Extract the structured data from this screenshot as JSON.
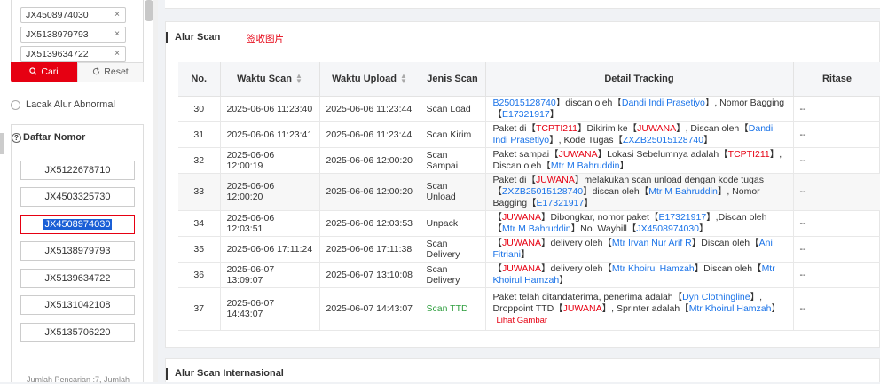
{
  "sidebar": {
    "tags": [
      "JX4508974030",
      "JX5138979793",
      "JX5139634722"
    ],
    "remove_glyph": "×",
    "cari_label": "Cari",
    "reset_label": "Reset",
    "lacak_label": "Lacak Alur Abnormal",
    "daftar_title": "Daftar Nomor",
    "daftar_items": [
      "JX5122678710",
      "JX4503325730",
      "JX4508974030",
      "JX5138979793",
      "JX5139634722",
      "JX5131042108",
      "JX5135706220"
    ],
    "footer_note": "Jumlah Pencarian :7, Jumlah"
  },
  "main": {
    "section_title": "Alur Scan",
    "section_link": "签收图片",
    "section2_title": "Alur Scan Internasional",
    "columns": [
      "No.",
      "Waktu Scan",
      "Waktu Upload",
      "Jenis Scan",
      "Detail Tracking",
      "Ritase"
    ],
    "rows": [
      {
        "no": "30",
        "scan": "2025-06-06 11:23:40",
        "upload": "2025-06-06 11:23:44",
        "jenis": "Scan Load",
        "ritase": "--"
      },
      {
        "no": "31",
        "scan": "2025-06-06 11:23:41",
        "upload": "2025-06-06 11:23:44",
        "jenis": "Scan Kirim",
        "ritase": "--"
      },
      {
        "no": "32",
        "scan": "2025-06-06 12:00:19",
        "upload": "2025-06-06 12:00:20",
        "jenis": "Scan Sampai",
        "ritase": "--"
      },
      {
        "no": "33",
        "scan": "2025-06-06 12:00:20",
        "upload": "2025-06-06 12:00:20",
        "jenis": "Scan Unload",
        "ritase": "--"
      },
      {
        "no": "34",
        "scan": "2025-06-06 12:03:51",
        "upload": "2025-06-06 12:03:53",
        "jenis": "Unpack",
        "ritase": "--"
      },
      {
        "no": "35",
        "scan": "2025-06-06 17:11:24",
        "upload": "2025-06-06 17:11:38",
        "jenis": "Scan Delivery",
        "ritase": "--"
      },
      {
        "no": "36",
        "scan": "2025-06-07 13:09:07",
        "upload": "2025-06-07 13:10:08",
        "jenis": "Scan Delivery",
        "ritase": "--"
      },
      {
        "no": "37",
        "scan": "2025-06-07 14:43:07",
        "upload": "2025-06-07 14:43:07",
        "jenis": "Scan TTD",
        "ritase": "--"
      }
    ],
    "details": {
      "r30": {
        "a": "B25015128740",
        "b": "】discan oleh【",
        "c": "Dandi Indi Prasetiyo",
        "d": "】, Nomor Bagging【",
        "e": "E17321917",
        "f": "】"
      },
      "r31": {
        "a": "Paket di【",
        "b": "TCPTI211",
        "c": "】Dikirim ke【",
        "d": "JUWANA",
        "e": "】, Discan oleh【",
        "f": "Dandi Indi Prasetiyo",
        "g": "】, Kode Tugas【",
        "h": "ZXZB25015128740",
        "i": "】"
      },
      "r32": {
        "a": "Paket sampai【",
        "b": "JUWANA",
        "c": "】Lokasi Sebelumnya adalah【",
        "d": "TCPTI211",
        "e": "】, Discan oleh【",
        "f": "Mtr M Bahruddin",
        "g": "】"
      },
      "r33": {
        "a": "Paket di【",
        "b": "JUWANA",
        "c": "】melakukan scan unload dengan kode tugas【",
        "d": "ZXZB25015128740",
        "e": "】discan oleh【",
        "f": "Mtr M Bahruddin",
        "g": "】, Nomor Bagging【",
        "h": "E17321917",
        "i": "】"
      },
      "r34": {
        "a": "【",
        "b": "JUWANA",
        "c": "】Dibongkar, nomor paket【",
        "d": "E17321917",
        "e": "】,Discan oleh【",
        "f": "Mtr M Bahruddin",
        "g": "】No. Waybill【",
        "h": "JX4508974030",
        "i": "】"
      },
      "r35": {
        "a": "【",
        "b": "JUWANA",
        "c": "】delivery oleh【",
        "d": "Mtr Irvan Nur Arif R",
        "e": "】Discan oleh【",
        "f": "Ani Fitriani",
        "g": "】"
      },
      "r36": {
        "a": "【",
        "b": "JUWANA",
        "c": "】delivery oleh【",
        "d": "Mtr Khoirul Hamzah",
        "e": "】Discan oleh【",
        "f": "Mtr Khoirul Hamzah",
        "g": "】"
      },
      "r37": {
        "a": "Paket telah ditandaterima, penerima adalah【",
        "b": "Dyn Clothingline",
        "c": "】, Droppoint TTD【",
        "d": "JUWANA",
        "e": "】, Sprinter adalah【",
        "f": "Mtr Khoirul Hamzah",
        "g": "】",
        "h": "Lihat Gambar"
      }
    }
  },
  "colors": {
    "accent": "#e60012",
    "link": "#1a73e8",
    "success": "#2e9e3e"
  }
}
